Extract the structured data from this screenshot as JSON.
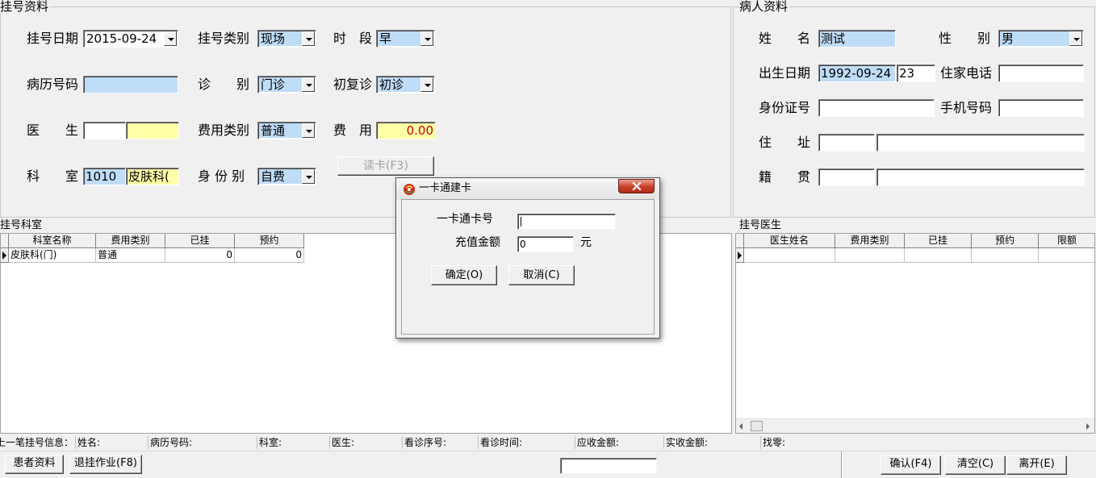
{
  "registration": {
    "title": "挂号资料",
    "date_label": "挂号日期",
    "date_value": "2015-09-24",
    "type_label": "挂号类别",
    "type_value": "现场",
    "period_label": "时　段",
    "period_value": "早",
    "record_label": "病历号码",
    "record_value": "",
    "visit_label": "诊　　别",
    "visit_value": "门诊",
    "revisit_label": "初复诊",
    "revisit_value": "初诊",
    "doctor_label": "医　　生",
    "doctor_code": "",
    "doctor_name": "",
    "fee_type_label": "费用类别",
    "fee_type_value": "普通",
    "fee_label": "费　用",
    "fee_value": "0.00",
    "dept_label": "科　　室",
    "dept_code": "1010",
    "dept_name": "皮肤科(",
    "identity_label": "身 份 别",
    "identity_value": "自费",
    "read_card_label": "读卡(F3)"
  },
  "patient": {
    "title": "病人资料",
    "name_label": "姓　　名",
    "name_value": "测试",
    "gender_label": "性　　别",
    "gender_value": "男",
    "birth_label": "出生日期",
    "birth_value": "1992-09-24",
    "age_value": "23",
    "phone_label": "住家电话",
    "phone_value": "",
    "id_label": "身份证号",
    "id_value": "",
    "mobile_label": "手机号码",
    "mobile_value": "",
    "address_label": "住　　址",
    "address_code": "",
    "address_value": "",
    "native_label": "籍　　贯",
    "native_code": "",
    "native_value": ""
  },
  "dept_grid": {
    "title": "挂号科室",
    "columns": [
      "科室名称",
      "费用类别",
      "已挂",
      "预约"
    ],
    "rows": [
      [
        "皮肤科(门)",
        "普通",
        "0",
        "0"
      ]
    ]
  },
  "doctor_grid": {
    "title": "挂号医生",
    "columns": [
      "医生姓名",
      "费用类别",
      "已挂",
      "预约",
      "限额"
    ]
  },
  "status_bar": {
    "prefix": "上一笔挂号信息：",
    "name": "姓名:",
    "record": "病历号码:",
    "dept": "科室:",
    "doctor": "医生:",
    "seq": "看诊序号:",
    "time": "看诊时间:",
    "due": "应收金额:",
    "paid": "实收金额:",
    "change": "找零:"
  },
  "toolbar": {
    "patient_btn": "患者资料",
    "cancel_reg_btn": "退挂作业(F8)",
    "confirm_btn": "确认(F4)",
    "clear_btn": "清空(C)",
    "exit_btn": "离开(E)"
  },
  "dialog": {
    "title": "一卡通建卡",
    "card_label": "一卡通卡号",
    "card_value": "",
    "amount_label": "充值金额",
    "amount_value": "0",
    "amount_unit": "元",
    "ok_btn": "确定(O)",
    "cancel_btn": "取消(C)"
  },
  "colors": {
    "field_blue": "#bfdcf8",
    "field_yellow": "#ffffa8",
    "fee_text": "#cc0000"
  }
}
